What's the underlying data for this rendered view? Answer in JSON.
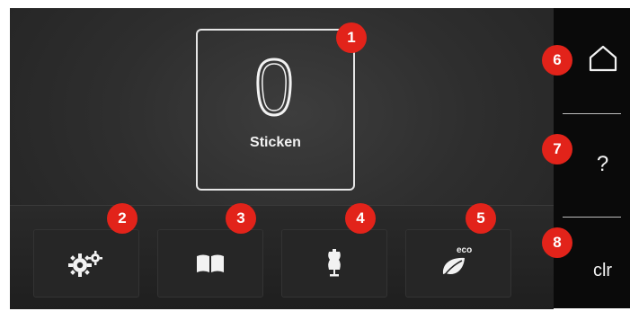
{
  "main_card": {
    "label": "Sticken",
    "icon": "embroidery-hoop-icon"
  },
  "bottom_bar": {
    "tiles": [
      {
        "icon": "settings-gears-icon"
      },
      {
        "icon": "tutorial-book-icon"
      },
      {
        "icon": "sewing-consultant-dressform-icon"
      },
      {
        "icon": "eco-mode-leaf-icon",
        "icon_text": "eco"
      }
    ]
  },
  "sidebar": {
    "home": {
      "icon": "home-icon"
    },
    "help": {
      "label": "?"
    },
    "clear": {
      "label": "clr"
    }
  },
  "callouts": [
    "1",
    "2",
    "3",
    "4",
    "5",
    "6",
    "7",
    "8"
  ],
  "colors": {
    "accent_red": "#e2231a",
    "screen_bg": "#2e2e2e",
    "sidebar_bg": "#0a0a0a",
    "text": "#f2f2f2"
  }
}
